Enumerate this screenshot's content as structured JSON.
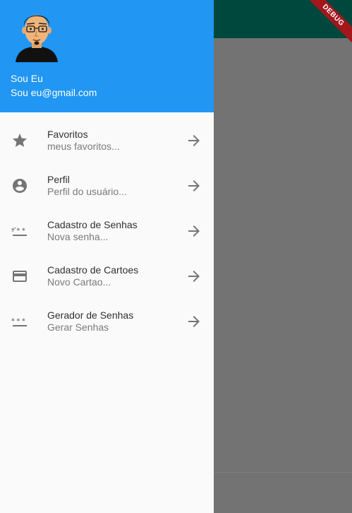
{
  "header": {
    "account_name": "Sou Eu",
    "account_email": "Sou eu@gmail.com"
  },
  "banner": {
    "label": "DEBUG"
  },
  "drawer": {
    "items": [
      {
        "icon": "star-icon",
        "title": "Favoritos",
        "subtitle": "meus favoritos..."
      },
      {
        "icon": "account-circle-icon",
        "title": "Perfil",
        "subtitle": "Perfil do usuário..."
      },
      {
        "icon": "password-icon",
        "title": "Cadastro de Senhas",
        "subtitle": "Nova senha..."
      },
      {
        "icon": "credit-card-icon",
        "title": "Cadastro de Cartoes",
        "subtitle": "Novo Cartao..."
      },
      {
        "icon": "password-icon",
        "title": "Gerador de Senhas",
        "subtitle": "Gerar Senhas"
      }
    ]
  },
  "colors": {
    "header_bg": "#2196f3",
    "appbar_bg": "#00473d",
    "scrim": "#737373",
    "icon": "#757575"
  }
}
